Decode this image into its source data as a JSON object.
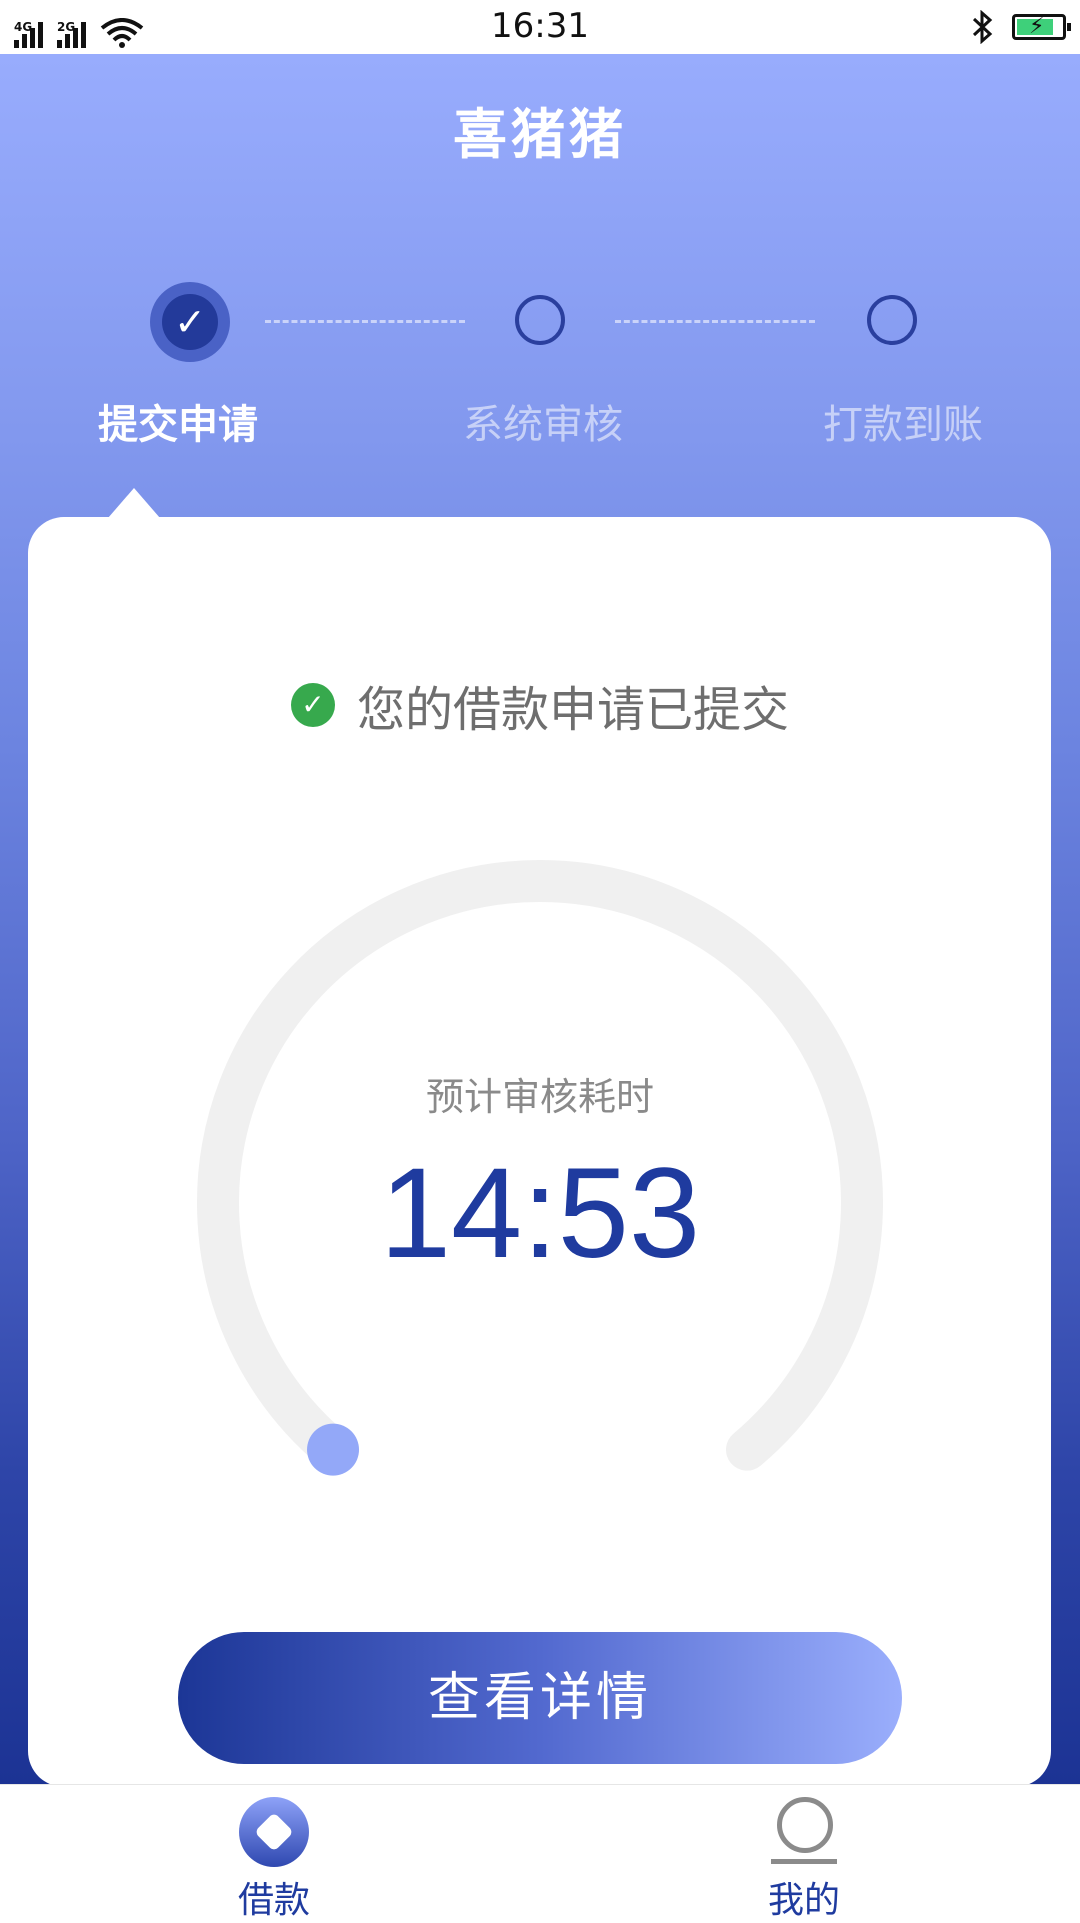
{
  "status_bar": {
    "network_1": "4G",
    "network_2": "2G",
    "time": "16:31",
    "icons": [
      "signal-icon",
      "wifi-icon",
      "bluetooth-icon",
      "battery-charging-icon"
    ]
  },
  "app": {
    "title": "喜猪猪"
  },
  "steps": [
    {
      "label": "提交申请",
      "done": true
    },
    {
      "label": "系统审核",
      "done": false
    },
    {
      "label": "打款到账",
      "done": false
    }
  ],
  "card": {
    "submitted_text": "您的借款申请已提交",
    "estimate_label": "预计审核耗时",
    "timer": "14:53",
    "progress_fraction": 0.0,
    "detail_button_label": "查看详情"
  },
  "bottom_nav": {
    "items": [
      {
        "label": "借款",
        "icon": "loan-diamond-icon",
        "active": true
      },
      {
        "label": "我的",
        "icon": "profile-icon",
        "active": false
      }
    ]
  },
  "colors": {
    "accent": "#1f3b9f",
    "gradient_top": "#98acfd",
    "gradient_bottom": "#1c3394",
    "success": "#37a94d",
    "gauge_track": "#f0f0f0",
    "gauge_knob": "#93a8f8"
  }
}
